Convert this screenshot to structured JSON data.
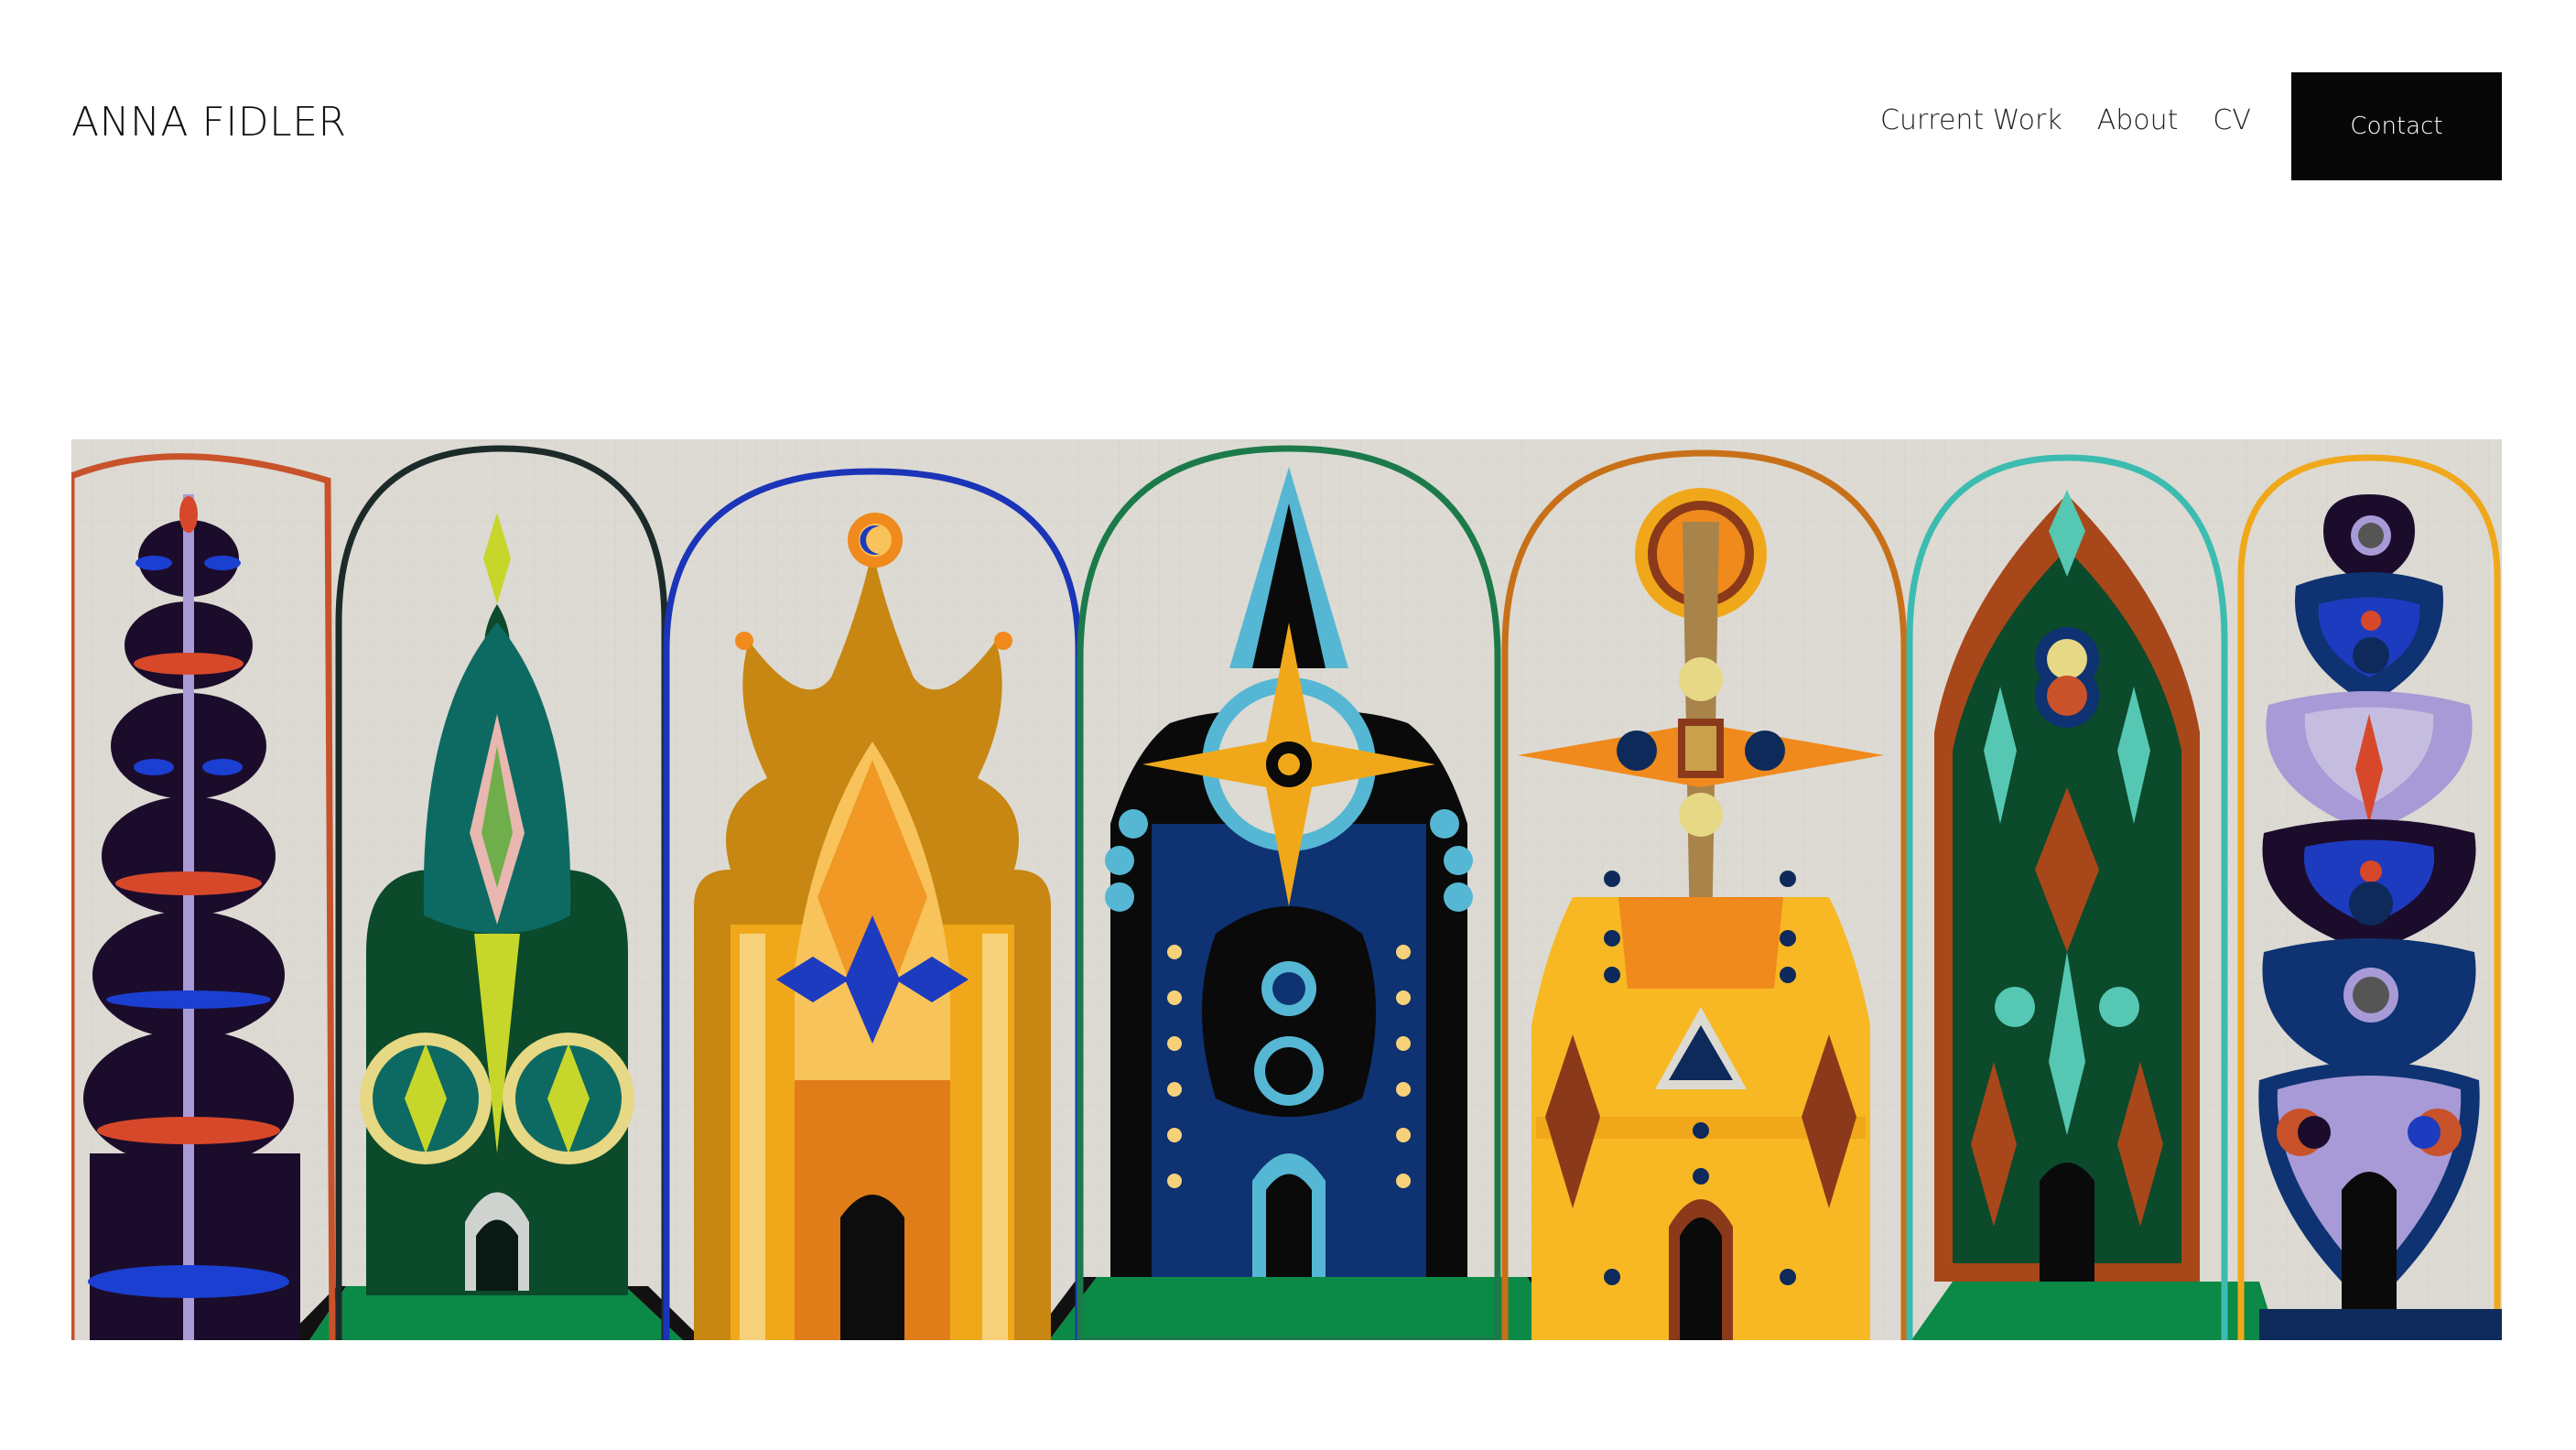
{
  "site": {
    "title": "ANNA FIDLER"
  },
  "nav": {
    "items": [
      {
        "label": "Current Work"
      },
      {
        "label": "About"
      },
      {
        "label": "CV"
      }
    ],
    "contact_label": "Contact"
  },
  "colors": {
    "background": "#ffffff",
    "button": "#070707",
    "canvas": "#dcdad3",
    "green_floor": "#0a8a46"
  },
  "icons": {}
}
